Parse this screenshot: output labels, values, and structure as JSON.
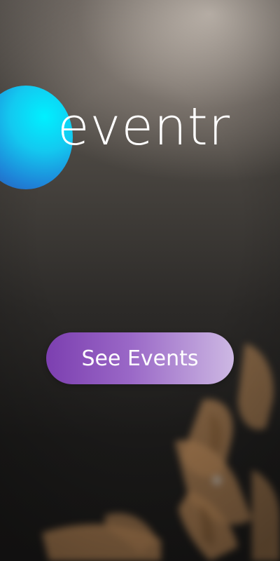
{
  "brand": {
    "name": "eventr",
    "logo_icon": "gradient-orb-icon",
    "orb_colors": [
      "#00f0ff",
      "#1e84d8",
      "#2a4fb0"
    ]
  },
  "cta": {
    "label": "See Events",
    "gradient_colors": [
      "#7c3fb0",
      "#cdb8e3"
    ]
  },
  "background": {
    "description_colors": [
      "#d7cdc3",
      "#2c2a28",
      "#1a1918"
    ]
  }
}
